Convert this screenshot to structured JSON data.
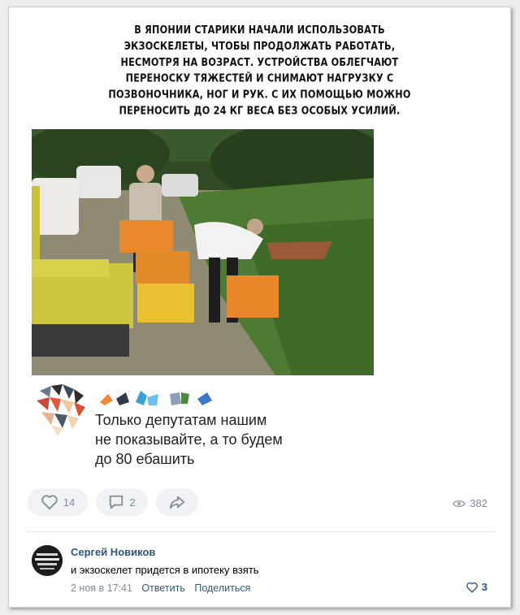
{
  "caption": {
    "lines": [
      "В Японии старики начали использовать",
      "экзоскелеты, чтобы продолжать работать,",
      "несмотря на возраст. Устройства облегчают",
      "переноску тяжестей и снимают нагрузку с",
      "позвоночника, ног и рук. С их помощью можно",
      "переносить до 24 кг веса без особых усилий."
    ]
  },
  "comment": {
    "lines": [
      "Только депутатам нашим",
      "не показывайте, а то будем",
      "до 80 ебашить"
    ]
  },
  "actions": {
    "likes": "14",
    "comments": "2",
    "views": "382"
  },
  "reply": {
    "author": "Сергей Новиков",
    "text": "и экзоскелет придется в ипотеку взять",
    "date": "2 ноя в 17:41",
    "reply_label": "Ответить",
    "share_label": "Поделиться",
    "likes": "3"
  },
  "icons": {
    "like": "heart-icon",
    "comment": "comment-icon",
    "share": "share-icon",
    "views": "eye-icon"
  },
  "colors": {
    "link": "#2a5885",
    "muted": "#818c99",
    "pill_bg": "#f0f2f5"
  }
}
